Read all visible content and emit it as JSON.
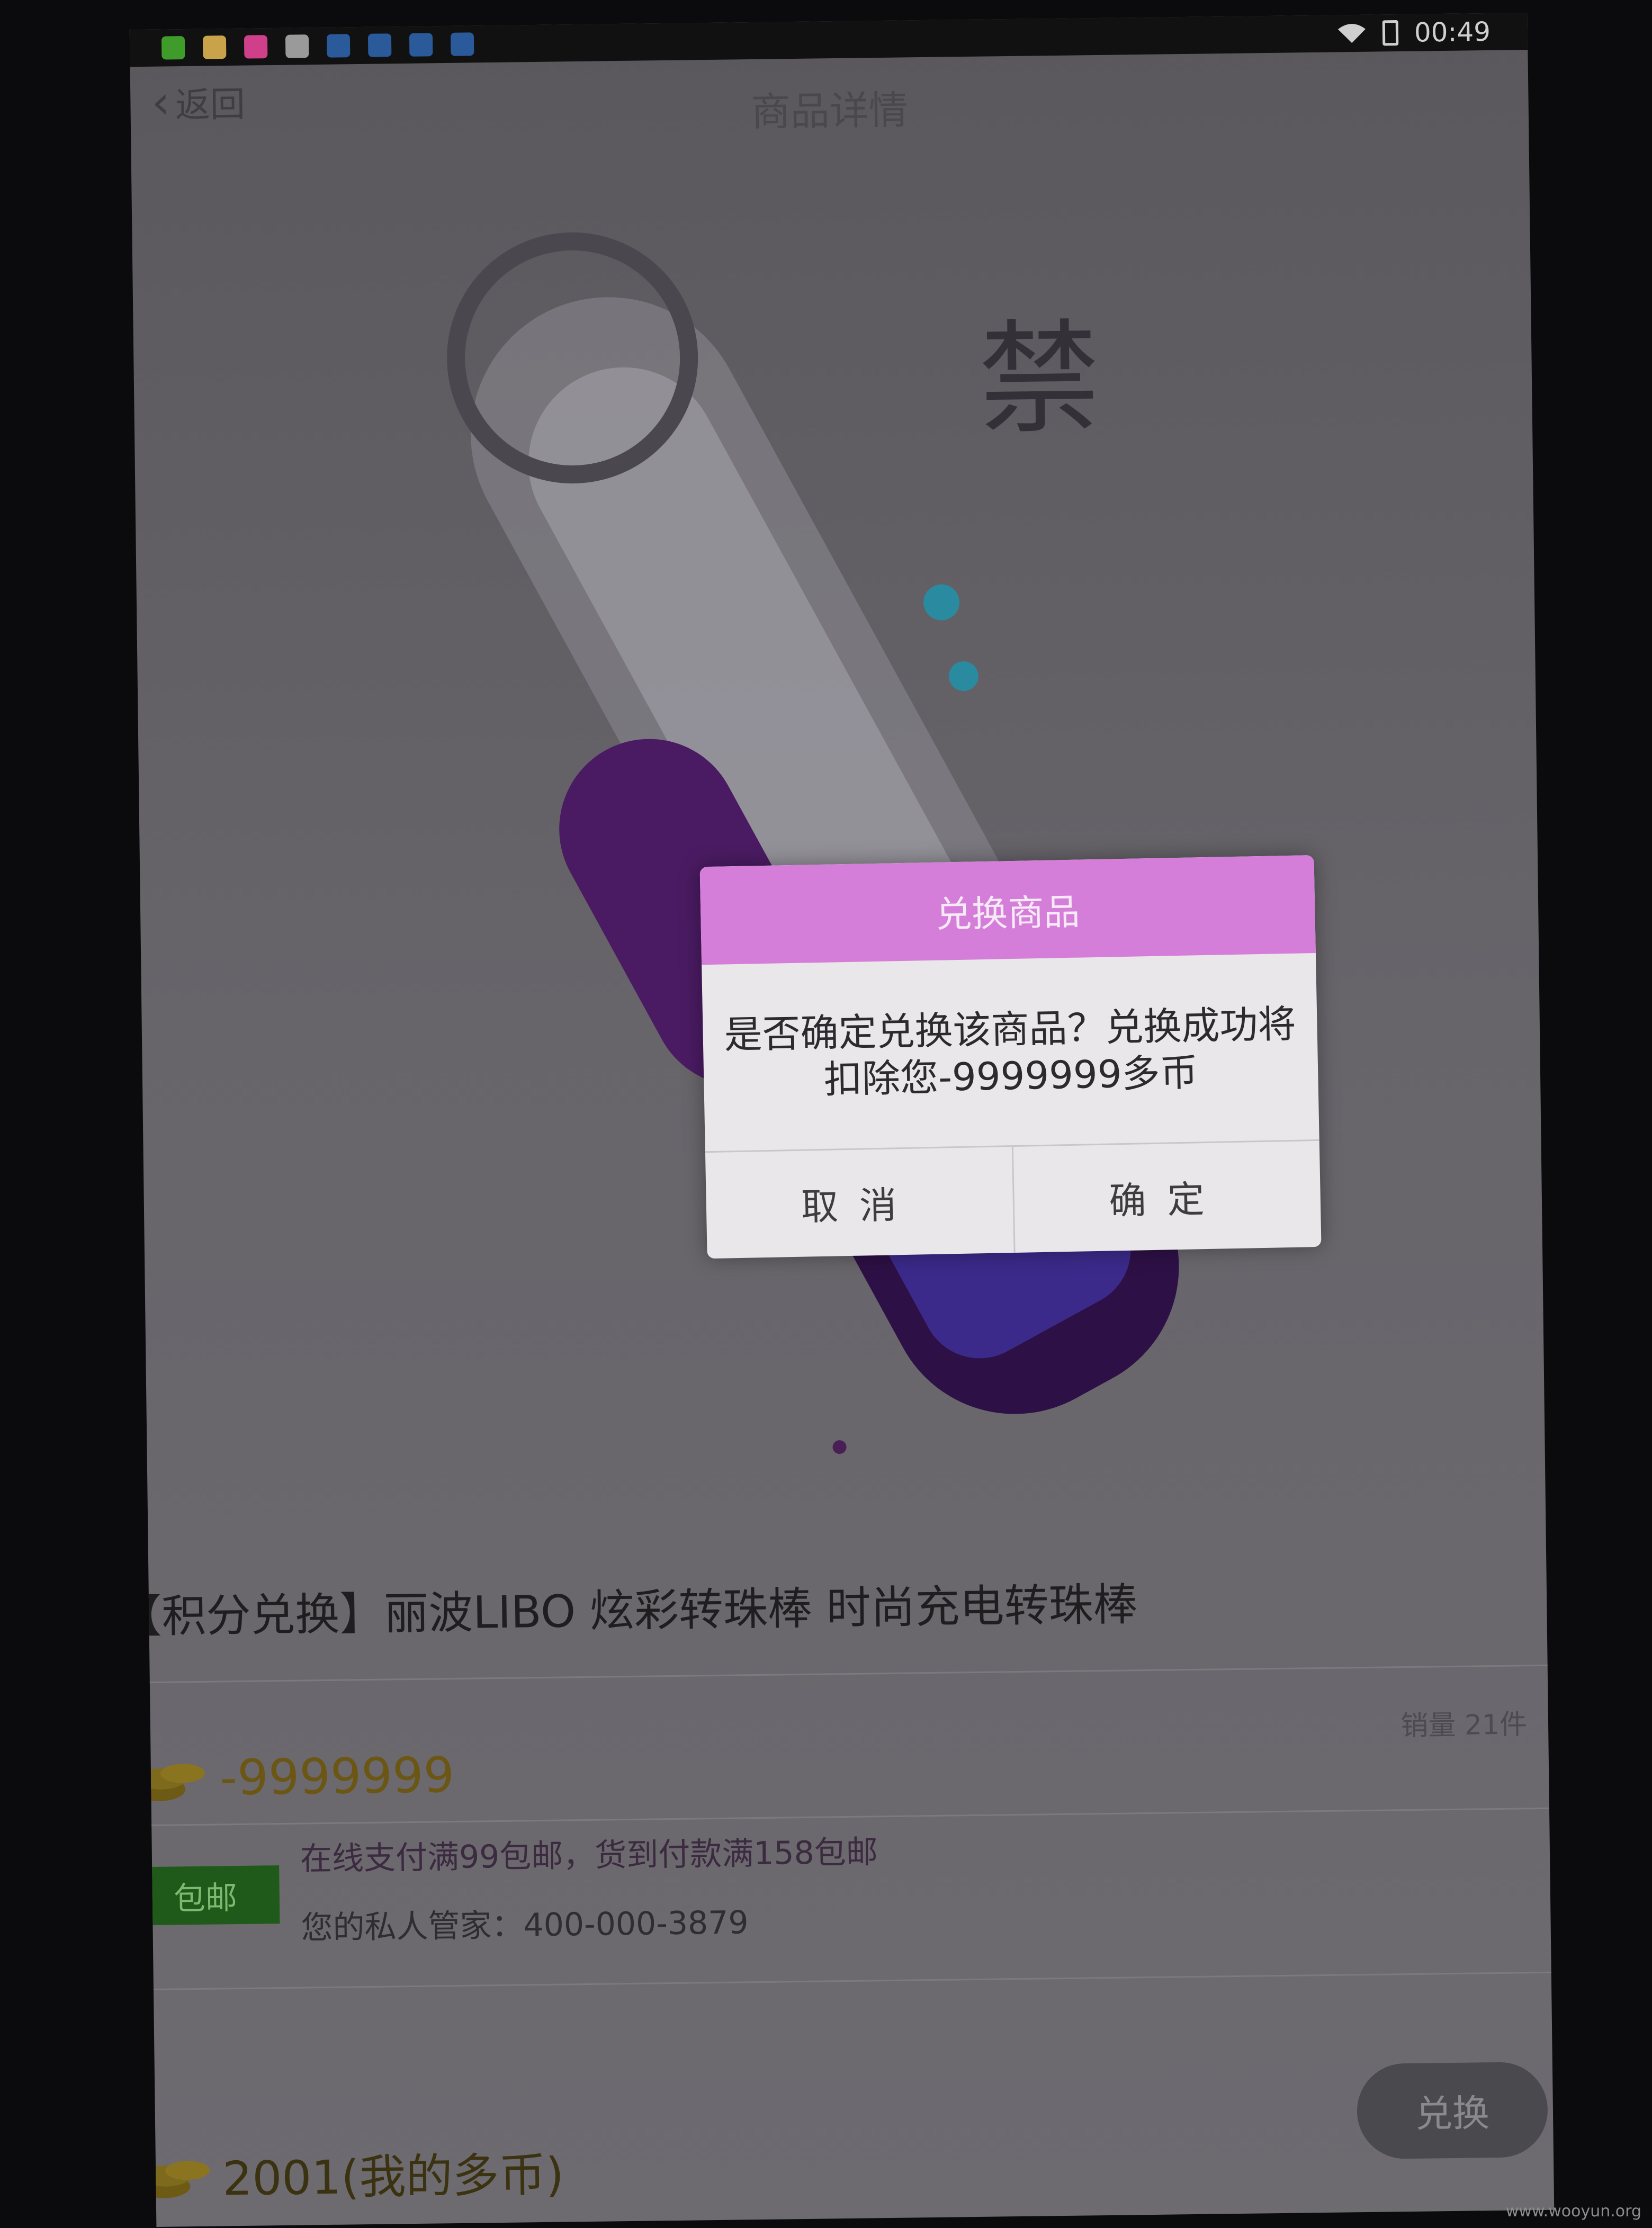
{
  "status_bar": {
    "time": "00:49"
  },
  "nav": {
    "back_label": "返回",
    "title": "商品详情"
  },
  "product": {
    "title": "【积分兑换】丽波LIBO 炫彩转珠棒 时尚充电转珠棒",
    "price": "-9999999",
    "sales": "销量 21件",
    "shipping_badge": "包邮",
    "shipping_note": "在线支付满99包邮，货到付款满158包邮",
    "service_line": "您的私人管家：400-000-3879"
  },
  "bottom_bar": {
    "my_coins": "2001(我的多币)",
    "exchange_label": "兑换"
  },
  "dialog": {
    "title": "兑换商品",
    "message_line1": "是否确定兑换该商品？兑换成功将",
    "message_line2": "扣除您-9999999多币",
    "cancel_label": "取消",
    "confirm_label": "确定"
  },
  "watermark": "www.wooyun.org",
  "colors": {
    "dialog_header": "#d57ed9",
    "badge": "#1f5a1a",
    "price": "#6b5613"
  },
  "icons": [
    "back-chevron-icon",
    "wifi-icon",
    "battery-icon",
    "coin-icon",
    "product-image",
    "carousel-dot"
  ]
}
